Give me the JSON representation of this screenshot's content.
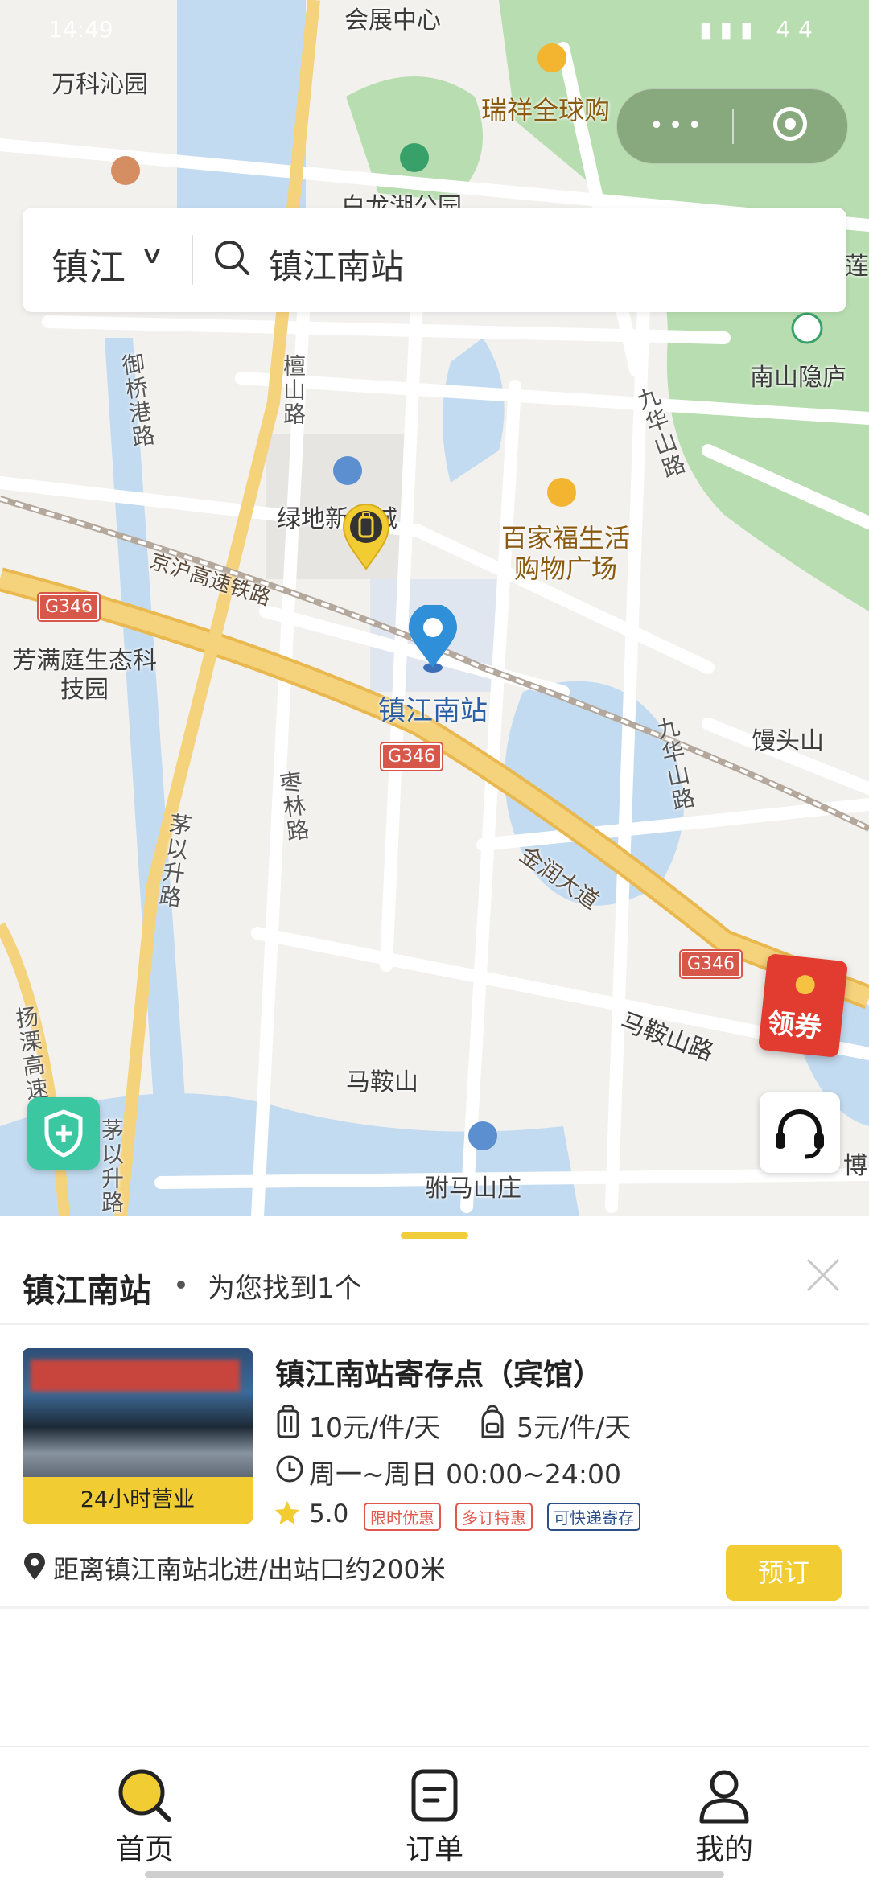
{
  "status_bar": {
    "time": "14:49",
    "battery": "44"
  },
  "capsule": {
    "more_icon": "more-dots-icon",
    "close_icon": "target-icon"
  },
  "search": {
    "city": "镇江",
    "query": "镇江南站"
  },
  "map": {
    "labels": {
      "convention_center": "会展中心",
      "vanke": "万科沁园",
      "ruixiang": "瑞祥全球购",
      "bailong_park": "白龙湖公园",
      "nanshan": "南山隐庐",
      "lian": "莲",
      "yuqiao_road": "御桥港路",
      "tanshan_road": "檀山路",
      "lvdi": "绿地新都城",
      "baijiafu": "百家福生活购物广场",
      "jiuhua_road_1": "九华山路",
      "jinghu_railway": "京沪高速铁路",
      "fangman": "芳满庭生态科技园",
      "station": "镇江南站",
      "mantou": "馒头山",
      "jiuhua_road_2": "九华山路",
      "zaolin_road": "枣林路",
      "maoyisheng_road": "茅以升路",
      "jinrun": "金润大道",
      "maanshan_road": "马鞍山路",
      "maanshan": "马鞍山",
      "yangli": "扬溧高速",
      "maoyisheng_road_2": "茅以升路",
      "fuma": "驸马山庄",
      "bo": "博"
    },
    "highway_shields": [
      "G346",
      "G346",
      "G346"
    ],
    "coupon": "领券"
  },
  "sheet": {
    "title": "镇江南站",
    "result_text": "为您找到1个",
    "store": {
      "name": "镇江南站寄存点（宾馆）",
      "badge": "24小时营业",
      "price_large": "10元/件/天",
      "price_small": "5元/件/天",
      "hours": "周一~周日 00:00~24:00",
      "rating": "5.0",
      "tags": [
        "限时优惠",
        "多订特惠",
        "可快递寄存"
      ],
      "distance": "距离镇江南站北进/出站口约200米",
      "book": "预订"
    }
  },
  "tabs": [
    {
      "label": "首页",
      "icon": "home-search-icon"
    },
    {
      "label": "订单",
      "icon": "order-icon"
    },
    {
      "label": "我的",
      "icon": "profile-icon"
    }
  ],
  "colors": {
    "accent": "#f1cc33",
    "pin_blue": "#2f8fd8",
    "park_green": "#a9d9a2",
    "water": "#b9d6f0",
    "highway": "#f3c96b"
  }
}
